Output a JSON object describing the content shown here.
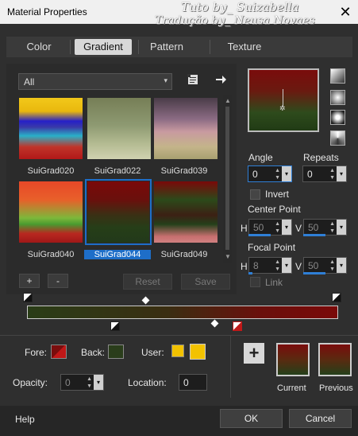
{
  "window": {
    "title": "Material Properties",
    "watermark_line1": "Tuto by_ Suizabella",
    "watermark_line2": "Tradução by_ Neusa Novaes",
    "close_glyph": "✕"
  },
  "tabs": [
    {
      "label": "Color",
      "active": false
    },
    {
      "label": "Gradient",
      "active": true
    },
    {
      "label": "Pattern",
      "active": false
    },
    {
      "label": "Texture",
      "active": false
    }
  ],
  "library": {
    "category": "All",
    "dropdown_arrow": "▾",
    "thumbnails": [
      {
        "label": "SuiGrad020",
        "selected": false
      },
      {
        "label": "SuiGrad022",
        "selected": false
      },
      {
        "label": "SuiGrad039",
        "selected": false
      },
      {
        "label": "SuiGrad040",
        "selected": false
      },
      {
        "label": "SuiGrad044",
        "selected": true
      },
      {
        "label": "SuiGrad049",
        "selected": false
      }
    ],
    "add_label": "+",
    "remove_label": "-",
    "reset_label": "Reset",
    "save_label": "Save"
  },
  "gradient_settings": {
    "angle_label": "Angle",
    "angle_value": "0",
    "repeats_label": "Repeats",
    "repeats_value": "0",
    "invert_label": "Invert",
    "center_point_label": "Center Point",
    "center_h_label": "H",
    "center_h_value": "50",
    "center_v_label": "V",
    "center_v_value": "50",
    "focal_point_label": "Focal Point",
    "focal_h_label": "H",
    "focal_h_value": "8",
    "focal_v_label": "V",
    "focal_v_value": "50",
    "link_label": "Link"
  },
  "colors": {
    "fore_label": "Fore:",
    "fore_color": "#7a0d0d",
    "back_label": "Back:",
    "back_color": "#2a3d1b",
    "user_label": "User:",
    "user_color": "#f2c200",
    "opacity_label": "Opacity:",
    "opacity_value": "0",
    "location_label": "Location:",
    "location_value": "0",
    "current_label": "Current",
    "previous_label": "Previous",
    "accent": "#1e6ec8"
  },
  "footer": {
    "help_label": "Help",
    "ok_label": "OK",
    "cancel_label": "Cancel"
  }
}
